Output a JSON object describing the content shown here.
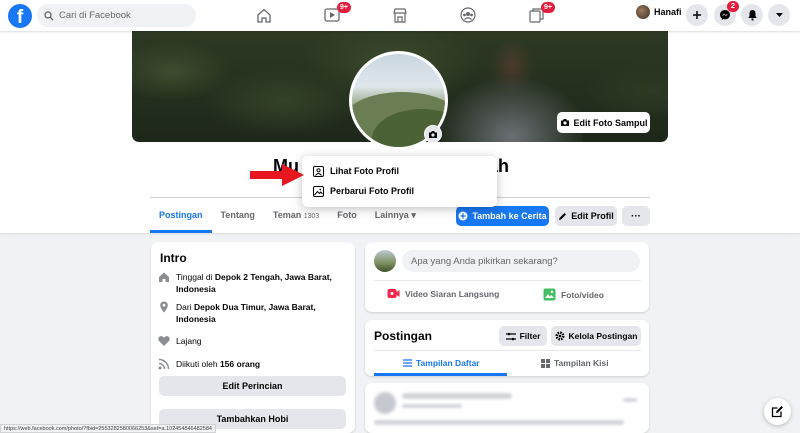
{
  "topbar": {
    "search_placeholder": "Cari di Facebook",
    "watch_badge": "9+",
    "groups_badge": "9+",
    "profile_name": "Hanafi",
    "messenger_badge": "2"
  },
  "cover": {
    "edit_label": "Edit Foto Sampul"
  },
  "profile": {
    "name_left": "Mu",
    "name_right": "yah"
  },
  "dropdown": {
    "items": [
      {
        "label": "Lihat Foto Profil",
        "icon": "user-square-icon"
      },
      {
        "label": "Perbarui Foto Profil",
        "icon": "image-icon"
      }
    ]
  },
  "tabs": {
    "items": [
      "Postingan",
      "Tentang",
      "Teman",
      "Foto",
      "Lainnya"
    ],
    "friends_count": "1303",
    "add_story": "Tambah ke Cerita",
    "edit_profile": "Edit Profil",
    "more": "···"
  },
  "intro": {
    "title": "Intro",
    "lives_prefix": "Tinggal di",
    "lives_place": "Depok 2 Tengah, Jawa Barat, Indonesia",
    "from_prefix": "Dari",
    "from_place": "Depok Dua Timur, Jawa Barat, Indonesia",
    "relationship": "Lajang",
    "followers_prefix": "Diikuti oleh",
    "followers_count": "156 orang",
    "edit_details": "Edit Perincian",
    "add_hobbies": "Tambahkan Hobi"
  },
  "composer": {
    "placeholder": "Apa yang Anda pikirkan sekarang?",
    "live_video": "Video Siaran Langsung",
    "photo_video": "Foto/video"
  },
  "posts": {
    "title": "Postingan",
    "filter": "Filter",
    "manage": "Kelola Postingan",
    "list_view": "Tampilan Daftar",
    "grid_view": "Tampilan Kisi"
  },
  "status_url": "https://web.facebook.com/photo/?fbid=2553282580066253&set=a.102454846482584",
  "colors": {
    "accent": "#1877f2",
    "badge": "#e41e3f",
    "arrow": "#e8161f",
    "live": "#f02849",
    "photo": "#45bd62"
  }
}
